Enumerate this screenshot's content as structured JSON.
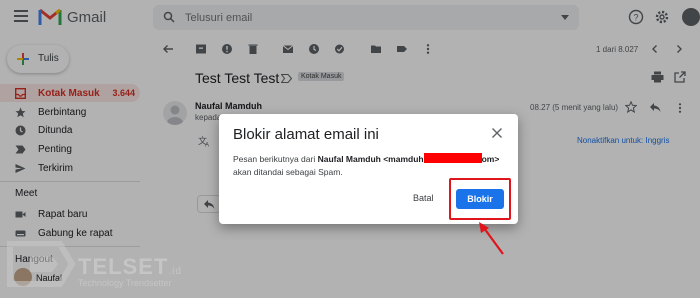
{
  "app": {
    "name": "Gmail"
  },
  "search": {
    "placeholder": "Telusuri email"
  },
  "sidebar": {
    "compose_label": "Tulis",
    "items": [
      {
        "label": "Kotak Masuk",
        "count": "3.644",
        "icon": "inbox-icon"
      },
      {
        "label": "Berbintang",
        "icon": "star-icon"
      },
      {
        "label": "Ditunda",
        "icon": "clock-icon"
      },
      {
        "label": "Penting",
        "icon": "important-icon"
      },
      {
        "label": "Terkirim",
        "icon": "send-icon"
      }
    ],
    "meet_heading": "Meet",
    "meet_items": [
      {
        "label": "Rapat baru",
        "icon": "video-icon"
      },
      {
        "label": "Gabung ke rapat",
        "icon": "keyboard-icon"
      }
    ],
    "hangout_heading": "Hangout",
    "hangout_user": "Naufal"
  },
  "toolbar": {
    "page_count": "1 dari 8.027"
  },
  "email": {
    "subject": "Test Test Test",
    "label": "Kotak Masuk",
    "sender": "Naufal Mamduh",
    "to_prefix": "kepada",
    "time": "08.27 (5 menit yang lalu)",
    "translate_off": "Nonaktifkan untuk: Inggris"
  },
  "dialog": {
    "title": "Blokir alamat email ini",
    "body_prefix": "Pesan berikutnya dari ",
    "body_name": "Naufal Mamduh <mamduh",
    "body_suffix": "om>",
    "body_line2": "akan ditandai sebagai Spam.",
    "cancel_label": "Batal",
    "block_label": "Blokir"
  },
  "watermark": {
    "brand": "TELSET",
    "tld": ".id",
    "tagline": "Technology Trendsetter"
  },
  "colors": {
    "accent": "#1a73e8",
    "inbox_active": "#d93025",
    "annotation": "#e0151b"
  }
}
